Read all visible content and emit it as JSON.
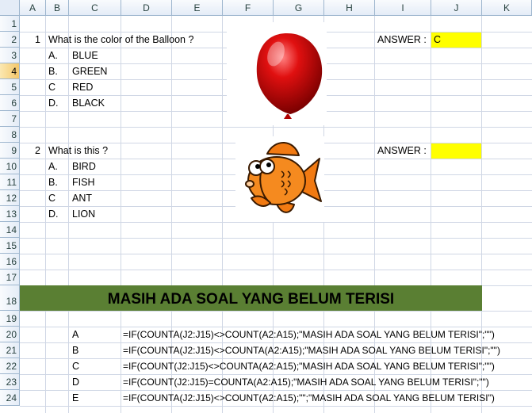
{
  "columns": [
    "A",
    "B",
    "C",
    "D",
    "E",
    "F",
    "G",
    "H",
    "I",
    "J",
    "K"
  ],
  "rows": [
    "1",
    "2",
    "3",
    "4",
    "5",
    "6",
    "7",
    "8",
    "9",
    "10",
    "11",
    "12",
    "13",
    "14",
    "15",
    "16",
    "17",
    "18",
    "19",
    "20",
    "21",
    "22",
    "23",
    "24"
  ],
  "q1": {
    "number": "1",
    "question": "What is the color of the Balloon ?",
    "options": [
      {
        "letter": "A.",
        "text": "BLUE"
      },
      {
        "letter": "B.",
        "text": "GREEN"
      },
      {
        "letter": "C",
        "text": "RED"
      },
      {
        "letter": "D.",
        "text": "BLACK"
      }
    ],
    "answer_label": "ANSWER :",
    "answer_value": "C",
    "image_icon": "red-balloon"
  },
  "q2": {
    "number": "2",
    "question": "What is this ?",
    "options": [
      {
        "letter": "A.",
        "text": "BIRD"
      },
      {
        "letter": "B.",
        "text": "FISH"
      },
      {
        "letter": "C",
        "text": "ANT"
      },
      {
        "letter": "D.",
        "text": "LION"
      }
    ],
    "answer_label": "ANSWER :",
    "answer_value": "",
    "image_icon": "orange-fish"
  },
  "banner": {
    "text": "MASIH ADA SOAL YANG BELUM TERISI",
    "color": "#5a7f33"
  },
  "formulas": [
    {
      "label": "A",
      "text": "=IF(COUNTA(J2:J15)<>COUNT(A2:A15);\"MASIH ADA SOAL YANG BELUM TERISI\";\"\")"
    },
    {
      "label": "B",
      "text": "=IF(COUNTA(J2:J15)<>COUNTA(A2:A15);\"MASIH ADA SOAL YANG BELUM TERISI\";\"\")"
    },
    {
      "label": "C",
      "text": "=IF(COUNT(J2:J15)<>COUNTA(A2:A15);\"MASIH ADA SOAL YANG BELUM TERISI\";\"\")"
    },
    {
      "label": "D",
      "text": "=IF(COUNT(J2:J15)=COUNTA(A2:A15);\"MASIH ADA SOAL YANG BELUM TERISI\";\"\")"
    },
    {
      "label": "E",
      "text": "=IF(COUNTA(J2:J15)<>COUNT(A2:A15);\"\";\"MASIH ADA SOAL YANG BELUM TERISI\")"
    }
  ],
  "colors": {
    "answer_fill": "#ffff00",
    "header_bg": "#e4ecf7",
    "selected_row": "#f4c76a"
  }
}
